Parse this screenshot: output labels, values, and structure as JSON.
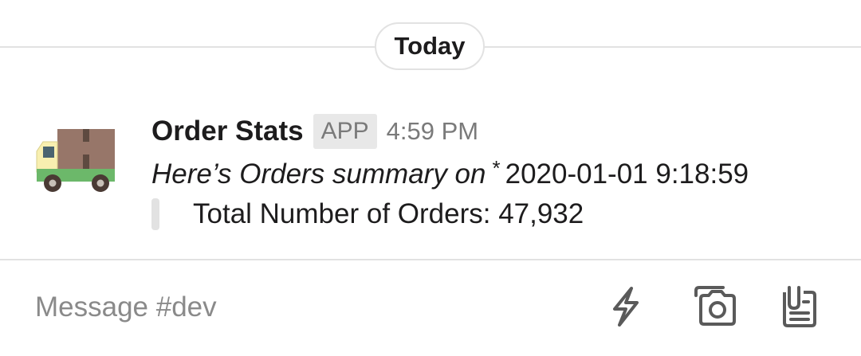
{
  "day_divider": {
    "label": "Today"
  },
  "message": {
    "avatar_icon": "delivery-truck-icon",
    "sender": "Order Stats",
    "badge": "APP",
    "time": "4:59 PM",
    "summary_italic": "Here’s Orders summary on",
    "summary_asterisk": "*",
    "summary_datetime": "2020-01-01 9:18:59",
    "attachment_text": "Total Number of Orders: 47,932"
  },
  "composer": {
    "placeholder": "Message #dev",
    "value": "",
    "buttons": [
      {
        "icon": "lightning-icon"
      },
      {
        "icon": "camera-icon"
      },
      {
        "icon": "files-icon"
      }
    ]
  },
  "colors": {
    "divider": "#e2e2e2",
    "muted_text": "#7a7a7a",
    "badge_bg": "#e8e8e8",
    "text": "#1d1c1d",
    "icon_gray": "#5a5a5a"
  }
}
